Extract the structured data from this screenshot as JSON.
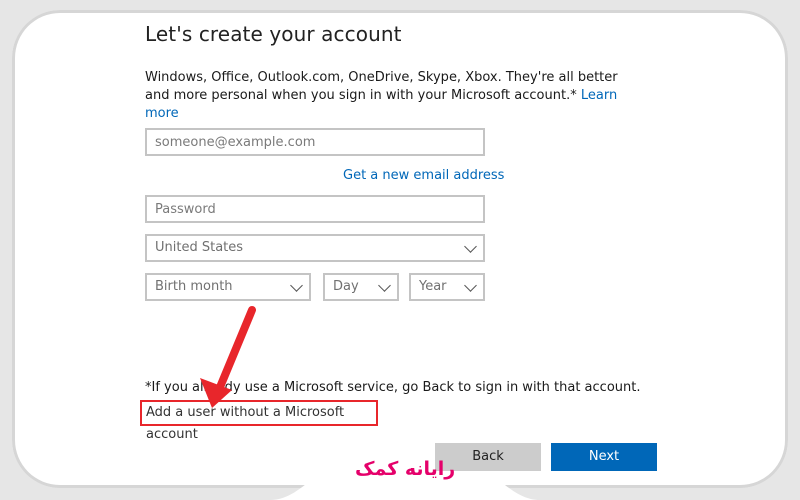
{
  "header": {
    "title": "Let's create your account",
    "description": "Windows, Office, Outlook.com, OneDrive, Skype, Xbox. They're all better and more personal when you sign in with your Microsoft account.*",
    "learn_more": "Learn more"
  },
  "form": {
    "email_placeholder": "someone@example.com",
    "get_new_email": "Get a new email address",
    "password_placeholder": "Password",
    "country": "United States",
    "birth_month": "Birth month",
    "day": "Day",
    "year": "Year"
  },
  "footer": {
    "note": "*If you already use a Microsoft service, go Back to sign in with that account.",
    "add_user_without_account": "Add a user without a Microsoft account",
    "back_label": "Back",
    "next_label": "Next"
  },
  "branding": {
    "logo_text": "رایانه کمک"
  },
  "colors": {
    "accent": "#0067b8",
    "highlight": "#e8262b",
    "logo": "#e5006a"
  }
}
